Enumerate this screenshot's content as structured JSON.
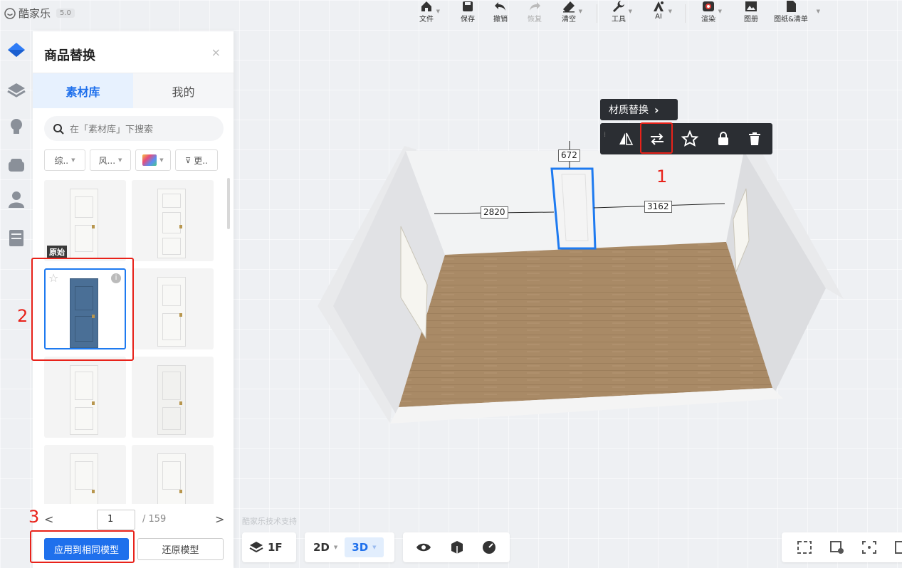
{
  "app": {
    "name": "酷家乐",
    "version": "5.0"
  },
  "toolbar": {
    "items": [
      {
        "label": "文件",
        "icon": "home-icon"
      },
      {
        "label": "保存",
        "icon": "save-icon"
      },
      {
        "label": "撤销",
        "icon": "undo-icon"
      },
      {
        "label": "恢复",
        "icon": "redo-icon"
      },
      {
        "label": "清空",
        "icon": "eraser-icon"
      },
      {
        "label": "工具",
        "icon": "wrench-icon"
      },
      {
        "label": "AI",
        "icon": "ai-icon"
      },
      {
        "label": "渲染",
        "icon": "render-icon"
      },
      {
        "label": "图册",
        "icon": "album-icon"
      },
      {
        "label": "图纸&清单",
        "icon": "document-icon"
      }
    ]
  },
  "sidebar": {
    "icons": [
      "floorplan-icon",
      "layers-icon",
      "light-icon",
      "furniture-icon",
      "person-icon",
      "cabinet-icon"
    ]
  },
  "panel": {
    "title": "商品替换",
    "close": "×",
    "tabs": [
      "素材库",
      "我的"
    ],
    "search_placeholder": "在「素材库」下搜索",
    "filters": [
      "综..",
      "风...",
      "",
      "更.."
    ],
    "original_badge": "原始",
    "pager": {
      "prev": "<",
      "current": "1",
      "total": "/ 159",
      "next": ">"
    },
    "apply_button": "应用到相同模型",
    "restore_button": "还原模型"
  },
  "annotations": {
    "n1": "1",
    "n2": "2",
    "n3": "3"
  },
  "context_menu": {
    "title": "材质替换",
    "arrow": "›"
  },
  "scene": {
    "dim_top": "672",
    "dim_left": "2820",
    "dim_right": "3162"
  },
  "watermark": "酷家乐技术支持",
  "bottom_bar": {
    "floor": "1F",
    "view2d": "2D",
    "view3d": "3D"
  },
  "colors": {
    "accent": "#1f70ec",
    "annotation": "#e8221a",
    "selection": "#1e7af0",
    "floor": "#a98a66"
  }
}
